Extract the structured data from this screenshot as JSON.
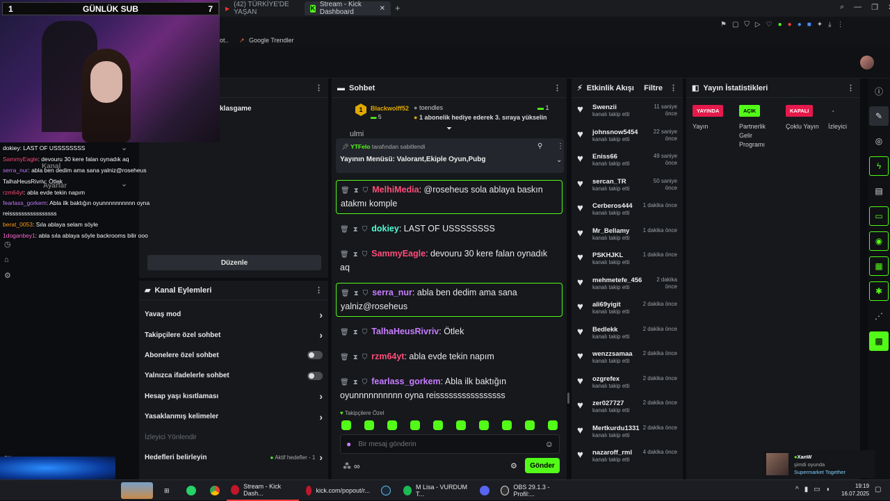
{
  "browser": {
    "tabs": [
      {
        "label": "(42) TÜRKİYE'DE YAŞAN"
      },
      {
        "label": "Stream - Kick Dashboard"
      }
    ],
    "bookmark": "Google Trendler",
    "bookmark_prefix": "ot.."
  },
  "overlay": {
    "sub_left": "1",
    "sub_title": "GÜNLÜK SUB",
    "sub_right": "7",
    "chat": [
      {
        "user": "dokiey",
        "text": ": LAST OF USSSSSSSS",
        "color": "#ffffff"
      },
      {
        "user": "SammyEagle",
        "text": ": devouru 30 kere falan oynadık aq",
        "color": "#ff4d7a"
      },
      {
        "user": "serra_nur",
        "text": ": abla ben dedim ama sana yalniz@roseheus",
        "color": "#c77dff"
      },
      {
        "user": "TalhaHeusRivriv",
        "text": ": Ötlek",
        "color": "#ffffff"
      },
      {
        "user": "rzm64yt",
        "text": ": abla evde tekin napım",
        "color": "#ff4d7a"
      },
      {
        "user": "fearlass_gorkem",
        "text": ": Abla ilk baktığın oyunnnnnnnnnn oyna reissssssssssssssss",
        "color": "#c77dff"
      },
      {
        "user": "berat_0053",
        "text": ": Sıla ablaya selam söyle",
        "color": "#ff9f1c"
      },
      {
        "user": "1doganbey1",
        "text": ": abla sıla ablaya söyle backrooms bilir ooo",
        "color": "#ff6ad5"
      }
    ]
  },
  "left": {
    "channel_partial": "klasgame",
    "menu_kanal": "Kanal",
    "menu_ayarlar": "Ayarlar",
    "edit_button": "Düzenle"
  },
  "channel_actions": {
    "title": "Kanal Eylemleri",
    "items": [
      {
        "label": "Yavaş mod",
        "control": "chevron"
      },
      {
        "label": "Takipçilere özel sohbet",
        "control": "chevron"
      },
      {
        "label": "Abonelere özel sohbet",
        "control": "toggle"
      },
      {
        "label": "Yalnızca ifadelerle sohbet",
        "control": "toggle"
      },
      {
        "label": "Hesap yaşı kısıtlaması",
        "control": "chevron"
      },
      {
        "label": "Yasaklanmış kelimeler",
        "control": "chevron"
      }
    ],
    "subheader": "İzleyici Yönlendir",
    "goals_label": "Hedefleri belirleyin",
    "goals_status": "Aktif hedefler - 1"
  },
  "chat": {
    "title": "Sohbet",
    "top_user1": "Blackwolff52",
    "top_user1_badge": "1",
    "top_user1_count": "5",
    "top_user2": "toendles",
    "top_user2_count": "1",
    "gift_text": "1 abonelik hediye ederek 3. sıraya yükselin",
    "pinned_by": "YTFelo",
    "pinned_suffix": "tarafından sabitlendi",
    "pinned_text": "Yayının Menüsü: Valorant,Ekiple Oyun,Pubg",
    "cut_text": "ulmi",
    "messages": [
      {
        "user": "MelhiMedia",
        "text": ": @roseheus sola ablaya baskın atakmı komple",
        "color": "#ff4d7a",
        "hl": true
      },
      {
        "user": "dokiey",
        "text": ": LAST OF USSSSSSSS",
        "color": "#53fcd2",
        "hl": false
      },
      {
        "user": "SammyEagle",
        "text": ": devouru 30 kere falan oynadık aq",
        "color": "#ff4d7a",
        "hl": false
      },
      {
        "user": "serra_nur",
        "text": ": abla ben dedim ama sana yalniz@roseheus",
        "color": "#c77dff",
        "hl": true
      },
      {
        "user": "TalhaHeusRivriv",
        "text": ": Ötlek",
        "color": "#c77dff",
        "hl": false
      },
      {
        "user": "rzm64yt",
        "text": ": abla evde tekin napım",
        "color": "#ff4d7a",
        "hl": false
      },
      {
        "user": "fearlass_gorkem",
        "text": ": Abla ilk baktığın oyunnnnnnnnnn oyna reissssssssssssssss",
        "color": "#c77dff",
        "hl": false
      },
      {
        "user": "berat_0053",
        "text": ": Sıla ablaya selam söyle",
        "color": "#ff9f1c",
        "hl": false
      },
      {
        "user": "1doganbey1",
        "text": ": abla sıla ablaya söyle backrooms bilir ooo",
        "color": "#ff4d7a",
        "hl": false
      }
    ],
    "emote_label": "Takipçilere Özel",
    "input_placeholder": "Bir mesaj gönderin",
    "send_label": "Gönder"
  },
  "feed": {
    "title": "Etkinlik Akışı",
    "filter": "Filtre",
    "action": "kanalı takip etti",
    "items": [
      {
        "name": "Swenzii",
        "time": "11 saniye önce"
      },
      {
        "name": "johnsnow5454",
        "time": "22 saniye önce"
      },
      {
        "name": "Eniss66",
        "time": "49 saniye önce"
      },
      {
        "name": "sercan_TR",
        "time": "50 saniye önce"
      },
      {
        "name": "Cerberos444",
        "time": "1 dakika önce"
      },
      {
        "name": "Mr_Bellamy",
        "time": "1 dakika önce"
      },
      {
        "name": "PSKHJKL",
        "time": "1 dakika önce"
      },
      {
        "name": "mehmetefe_456",
        "time": "2 dakika önce"
      },
      {
        "name": "ali69yigit",
        "time": "2 dakika önce"
      },
      {
        "name": "Bedlekk",
        "time": "2 dakika önce"
      },
      {
        "name": "wenzzsamaa",
        "time": "2 dakika önce"
      },
      {
        "name": "ozgrefex",
        "time": "2 dakika önce"
      },
      {
        "name": "zer027727",
        "time": "2 dakika önce"
      },
      {
        "name": "Mertkurdu1331",
        "time": "2 dakika önce"
      },
      {
        "name": "nazaroff_rml",
        "time": "4 dakika önce"
      }
    ]
  },
  "stats": {
    "title": "Yayın İstatistikleri",
    "cols": [
      {
        "badge": "YAYINDA",
        "label": "Yayın",
        "color": "#e5194b"
      },
      {
        "badge": "AÇIK",
        "label": "Partnerlik Gelir Programı",
        "color": "#53fc18"
      },
      {
        "badge": "KAPALI",
        "label": "Çoklu Yayın",
        "color": "#e5194b"
      },
      {
        "badge": "-",
        "label": "İzleyici",
        "color": ""
      }
    ]
  },
  "notification": {
    "name": "XanW",
    "sub": "şimdi oyunda",
    "game": "Supermarket Together"
  },
  "taskbar": {
    "apps": [
      {
        "label": "Stream - Kick Dash..."
      },
      {
        "label": "kick.com/popout/r..."
      },
      {
        "label": "M Lisa - VURDUM T..."
      },
      {
        "label": "OBS 29.1.3 - Profil:..."
      }
    ],
    "time": "19:19",
    "date": "16.07.2025"
  }
}
